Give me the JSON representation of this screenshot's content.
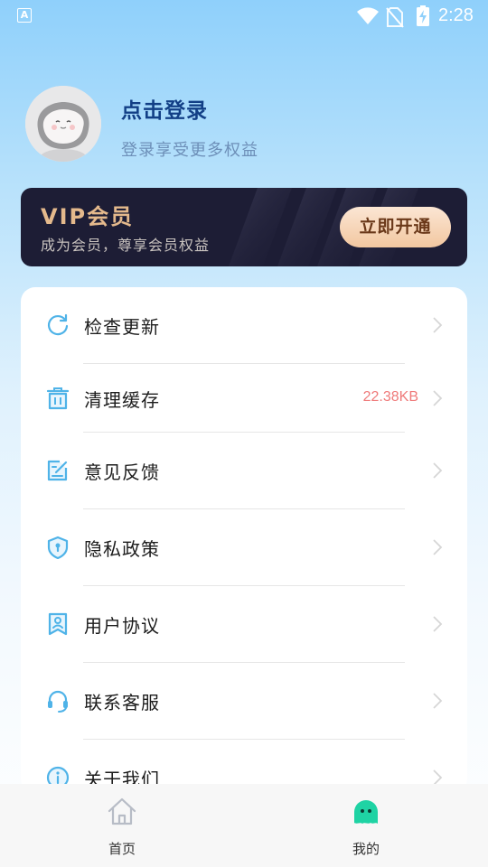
{
  "status_bar": {
    "time": "2:28",
    "notification_icon": "accessibility-a-icon",
    "icons": [
      "wifi-icon",
      "no-sim-icon",
      "battery-charging-icon"
    ]
  },
  "profile": {
    "title": "点击登录",
    "subtitle": "登录享受更多权益",
    "avatar_icon": "astronaut-cat-avatar"
  },
  "vip": {
    "title": "VIP会员",
    "subtitle": "成为会员，尊享会员权益",
    "button_label": "立即开通"
  },
  "menu": {
    "items": [
      {
        "label": "检查更新",
        "icon": "refresh-icon",
        "value": ""
      },
      {
        "label": "清理缓存",
        "icon": "trash-icon",
        "value": "22.38KB"
      },
      {
        "label": "意见反馈",
        "icon": "edit-feedback-icon",
        "value": ""
      },
      {
        "label": "隐私政策",
        "icon": "shield-lock-icon",
        "value": ""
      },
      {
        "label": "用户协议",
        "icon": "user-agreement-icon",
        "value": ""
      },
      {
        "label": "联系客服",
        "icon": "headset-icon",
        "value": ""
      },
      {
        "label": "关于我们",
        "icon": "info-icon",
        "value": ""
      }
    ]
  },
  "bottom_nav": {
    "items": [
      {
        "label": "首页",
        "icon": "home-icon",
        "active": false
      },
      {
        "label": "我的",
        "icon": "ghost-mascot-icon",
        "active": true
      }
    ]
  },
  "colors": {
    "accent_blue": "#4fb3e8",
    "vip_gold": "#e4b98c",
    "cache_value": "#ef7a7a",
    "active_tab": "#1fd3a4"
  }
}
